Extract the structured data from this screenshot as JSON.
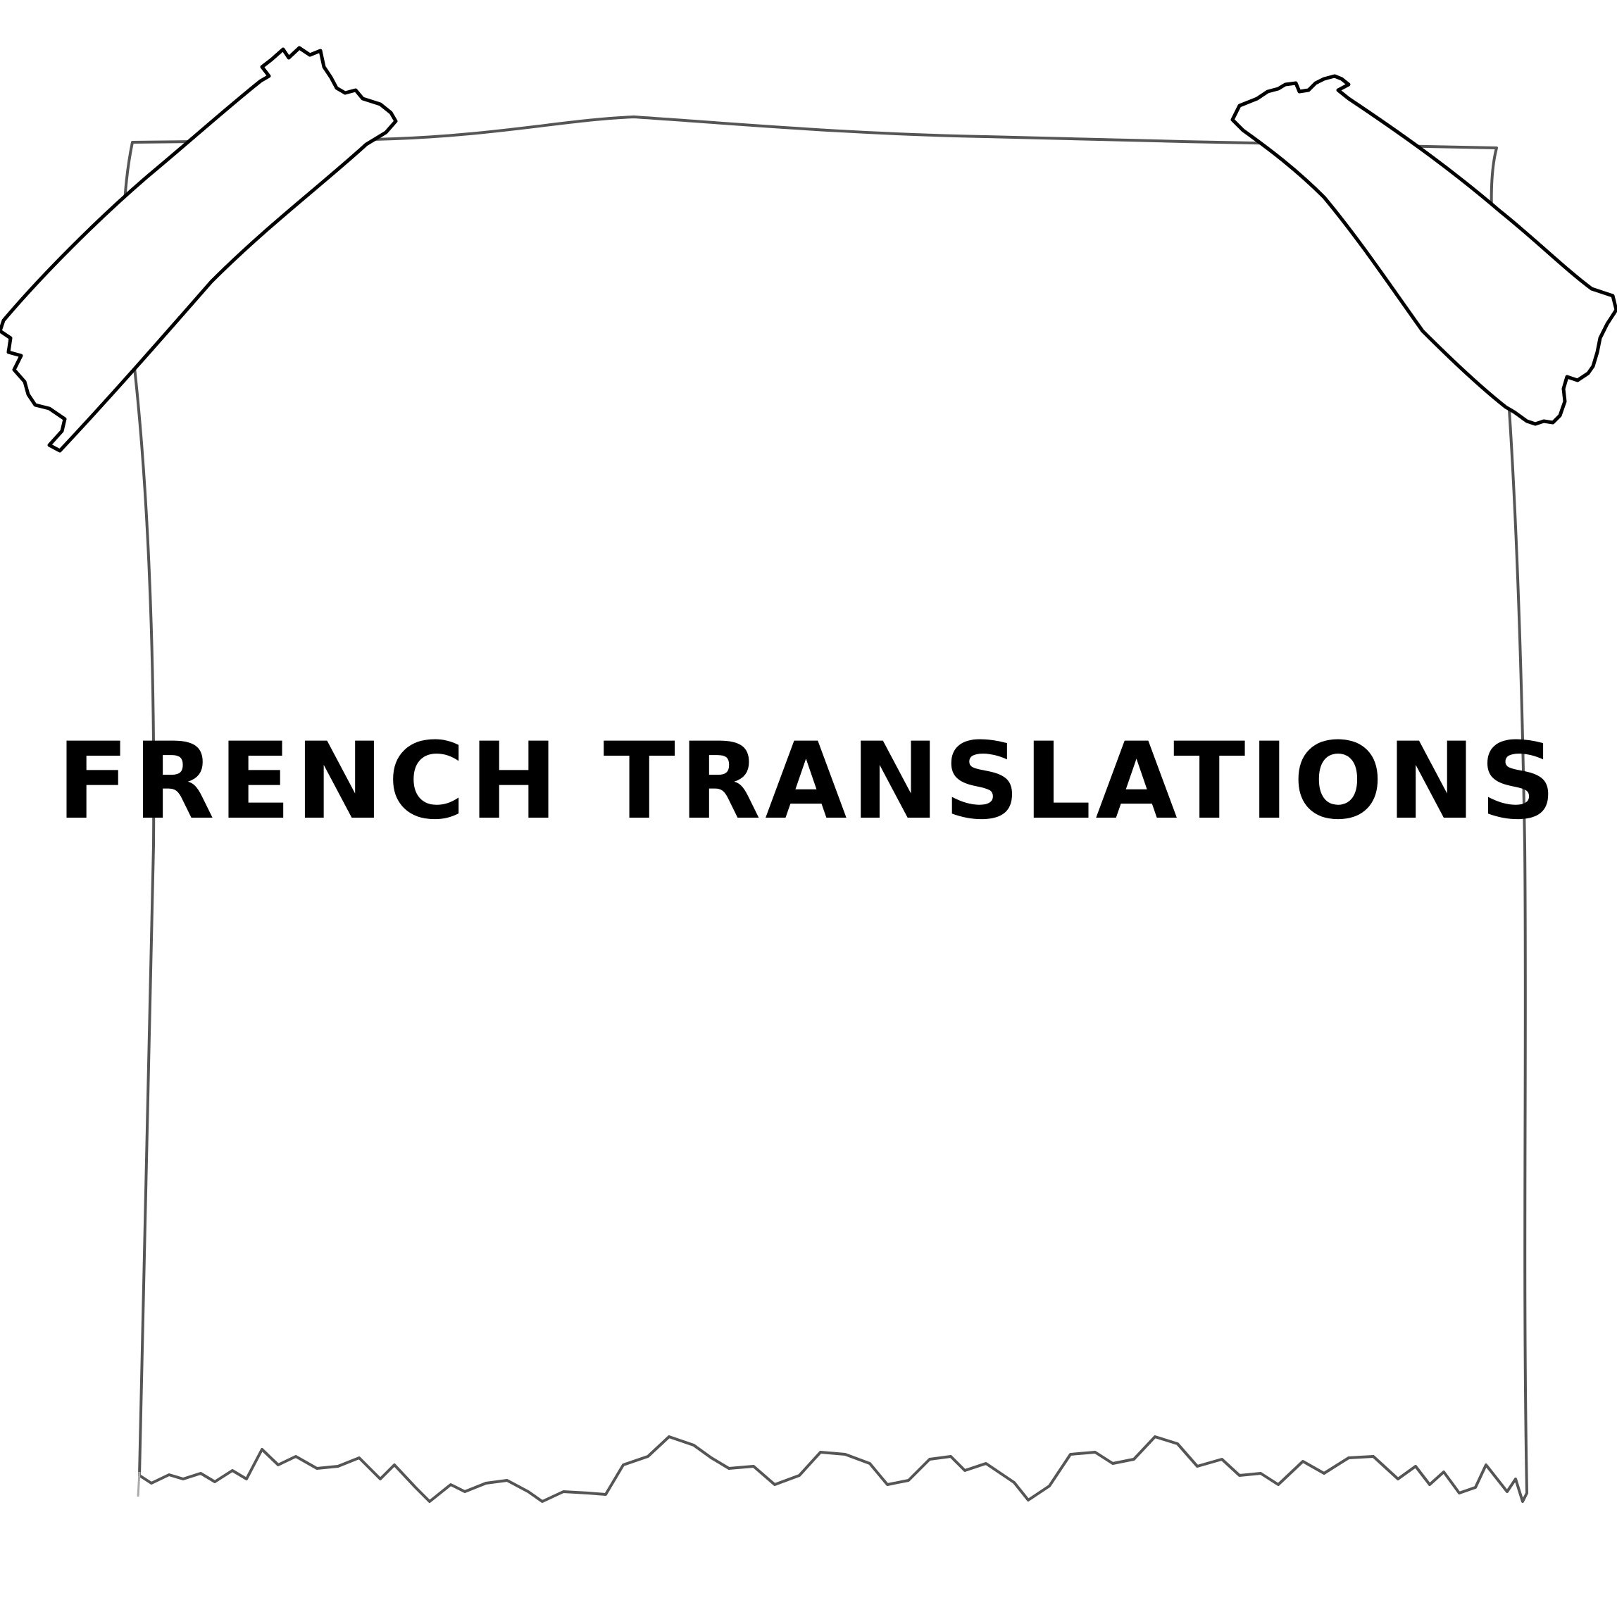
{
  "note": {
    "title": "FRENCH TRANSLATIONS",
    "paper_color": "#ffffff",
    "ink_color": "#000000",
    "outline_color": "#555555"
  },
  "icons": {
    "left_tape": "tape-strip-icon",
    "right_tape": "tape-strip-icon"
  }
}
